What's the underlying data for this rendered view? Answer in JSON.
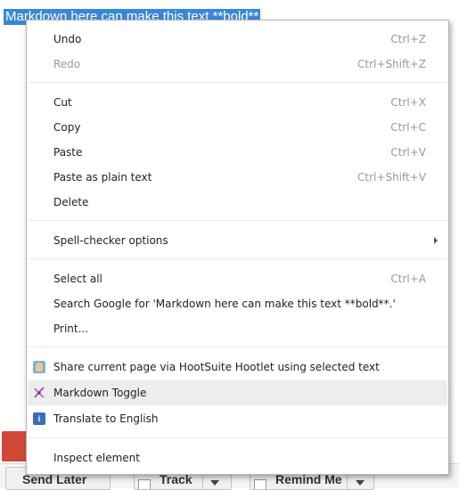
{
  "selected_text": "Markdown here can make this text **bold**",
  "menu": {
    "undo": {
      "label": "Undo",
      "shortcut": "Ctrl+Z"
    },
    "redo": {
      "label": "Redo",
      "shortcut": "Ctrl+Shift+Z"
    },
    "cut": {
      "label": "Cut",
      "shortcut": "Ctrl+X"
    },
    "copy": {
      "label": "Copy",
      "shortcut": "Ctrl+C"
    },
    "paste": {
      "label": "Paste",
      "shortcut": "Ctrl+V"
    },
    "paste_plain": {
      "label": "Paste as plain text",
      "shortcut": "Ctrl+Shift+V"
    },
    "delete": {
      "label": "Delete"
    },
    "spell": {
      "label": "Spell-checker options"
    },
    "select_all": {
      "label": "Select all",
      "shortcut": "Ctrl+A"
    },
    "search_google": {
      "label": "Search Google for 'Markdown here can make this text **bold**.'"
    },
    "print": {
      "label": "Print..."
    },
    "hootsuite": {
      "label": "Share current page via HootSuite Hootlet using selected text",
      "icon": "hootsuite-icon"
    },
    "markdown_toggle": {
      "label": "Markdown Toggle",
      "icon": "markdown-here-icon"
    },
    "translate": {
      "label": "Translate to English",
      "icon": "google-translate-icon"
    },
    "inspect": {
      "label": "Inspect element"
    }
  },
  "bottom_toolbar": {
    "send_later": "Send Later",
    "track": "Track",
    "remind_me": "Remind Me"
  },
  "colors": {
    "selection": "#3a87d8",
    "send_button": "#d14836",
    "highlight": "#ededed"
  }
}
